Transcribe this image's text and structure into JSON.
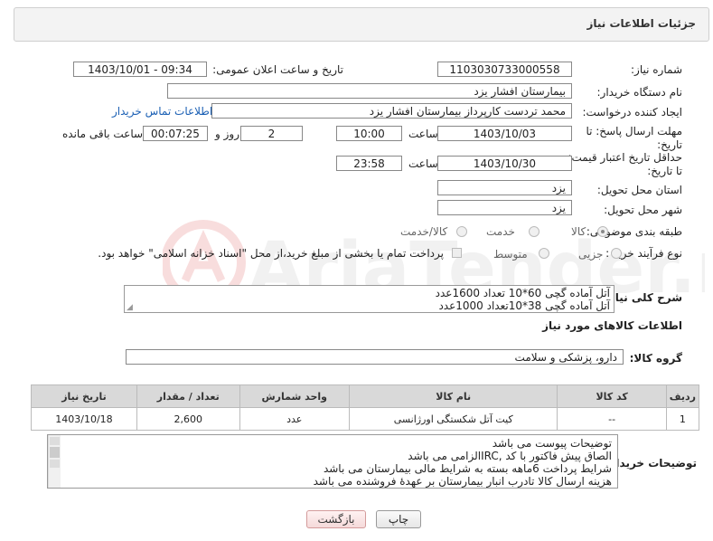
{
  "header": {
    "title": "جزئیات اطلاعات نیاز"
  },
  "form": {
    "need_number_label": "شماره نیاز:",
    "need_number": "1103030733000558",
    "announce_label": "تاریخ و ساعت اعلان عمومی:",
    "announce_value": "1403/10/01 - 09:34",
    "buyer_org_label": "نام دستگاه خریدار:",
    "buyer_org": "بیمارستان افشار یزد",
    "creator_label": "ایجاد کننده درخواست:",
    "creator": "محمد تردست کارپرداز بیمارستان افشار یزد",
    "contact_link": "اطلاعات تماس خریدار",
    "reply_deadline_label": "مهلت ارسال پاسخ: تا تاریخ:",
    "reply_date": "1403/10/03",
    "time_label": "ساعت",
    "reply_time": "10:00",
    "days": "2",
    "days_label": "روز و",
    "remaining": "00:07:25",
    "remaining_label": "ساعت باقی مانده",
    "price_validity_label": "حداقل تاریخ اعتبار قیمت: تا تاریخ:",
    "price_date": "1403/10/30",
    "price_time": "23:58",
    "province_label": "استان محل تحویل:",
    "province": "یزد",
    "city_label": "شهر محل تحویل:",
    "city": "یزد",
    "category_label": "طبقه بندی موضوعی:",
    "category_options": [
      "کالا",
      "خدمت",
      "کالا/خدمت"
    ],
    "category_selected": "کالا",
    "process_label": "نوع فرآیند خرید :",
    "process_options": [
      "جزیی",
      "متوسط"
    ],
    "payment_note": "پرداخت تمام یا بخشی از مبلغ خرید،از محل \"اسناد خزانه اسلامی\" خواهد بود."
  },
  "summary": {
    "label": "شرح کلی نیاز:",
    "lines": [
      "آتل آماده گچی 60*10 تعداد 1600عدد",
      "آتل آماده گچی 38*10تعداد 1000عدد"
    ]
  },
  "goods": {
    "section_title": "اطلاعات کالاهای مورد نیاز",
    "group_label": "گروه کالا:",
    "group_value": "دارو، پزشکی و سلامت",
    "columns": [
      "ردیف",
      "کد کالا",
      "نام کالا",
      "واحد شمارش",
      "تعداد / مقدار",
      "تاریخ نیاز"
    ],
    "rows": [
      [
        "1",
        "--",
        "کیت آتل شکستگی اورژانسی",
        "عدد",
        "2,600",
        "1403/10/18"
      ]
    ]
  },
  "buyer_notes": {
    "label": "توضیحات خریدار:",
    "lines": [
      "توضیحات پیوست می باشد",
      "الصاق پیش فاکتور با کد  ,IRCالزامی می باشد",
      "شرایط پرداخت    6ماهه بسته به شرایط مالی بیمارستان می باشد",
      "هزینه ارسال کالا تادرب انبار بیمارستان بر عهدهٔ فروشنده می باشد"
    ]
  },
  "buttons": {
    "print": "چاپ",
    "back": "بازگشت"
  },
  "colors": {
    "link": "#1a5fb4",
    "header_bg": "#f3f3f3",
    "table_header": "#d9d9d9"
  }
}
